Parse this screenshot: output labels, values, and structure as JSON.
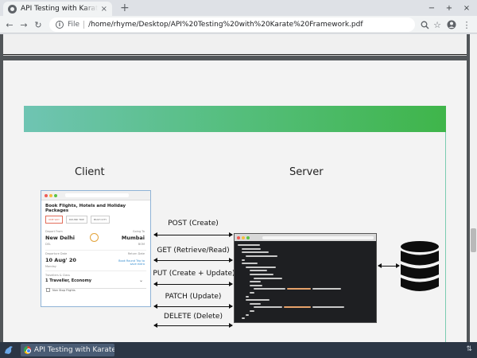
{
  "browser": {
    "tab_title": "API Testing with Karate Fra",
    "tab_close": "×",
    "new_tab": "+",
    "window_buttons": [
      "−",
      "+",
      "×"
    ],
    "nav": {
      "back": "←",
      "forward": "→",
      "reload": "↻"
    },
    "address": {
      "scheme": "File",
      "url": "/home/rhyme/Desktop/API%20Testing%20with%20Karate%20Framework.pdf"
    }
  },
  "slide": {
    "client_heading": "Client",
    "server_heading": "Server",
    "banner_colors": [
      "#6fc4b3",
      "#3fb54a"
    ],
    "methods": [
      "POST (Create)",
      "GET (Retrieve/Read)",
      "PUT (Create + Update)",
      "PATCH (Update)",
      "DELETE (Delete)"
    ],
    "client_mock": {
      "title": "Book Flights, Hotels and Holiday Packages",
      "tabs": [
        "ONE WAY",
        "ROUND TRIP",
        "MULTI CITY"
      ],
      "from_label": "Depart From",
      "from_city": "New Delhi",
      "from_code": "DEL",
      "to_label": "Going To",
      "to_city": "Mumbai",
      "to_code": "BOM",
      "depart_label": "Departure Date",
      "depart_date": "10 Aug' 20",
      "depart_day": "Monday",
      "return_label": "Return Date",
      "return_link": "Book Round Trip to save extra",
      "travellers_label": "Travellers & Class",
      "travellers_value": "1 Traveller, Economy",
      "non_stop": "Non Stop Flights"
    },
    "window_dot_colors": [
      "#ee5b55",
      "#f6bd3d",
      "#5cc444"
    ]
  },
  "taskbar": {
    "task_label": "API Testing with Karate ...",
    "tray": "⇅"
  }
}
